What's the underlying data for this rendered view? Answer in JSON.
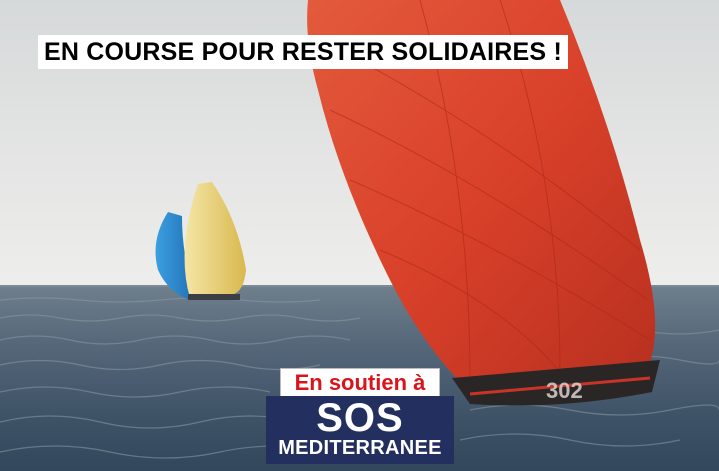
{
  "headline": "EN COURSE POUR RESTER SOLIDAIRES !",
  "support": {
    "label": "En soutien à",
    "logo_line1": "SOS",
    "logo_line2": "MEDITERRANEE"
  },
  "boat": {
    "sail_number": "302"
  },
  "colors": {
    "headline_bg": "#ffffff",
    "support_text": "#d9141b",
    "logo_bg": "#232f5e",
    "spinnaker_red": "#e0452c",
    "spinnaker_yellow": "#e8cf7a",
    "spinnaker_blue": "#2f8fd0"
  }
}
